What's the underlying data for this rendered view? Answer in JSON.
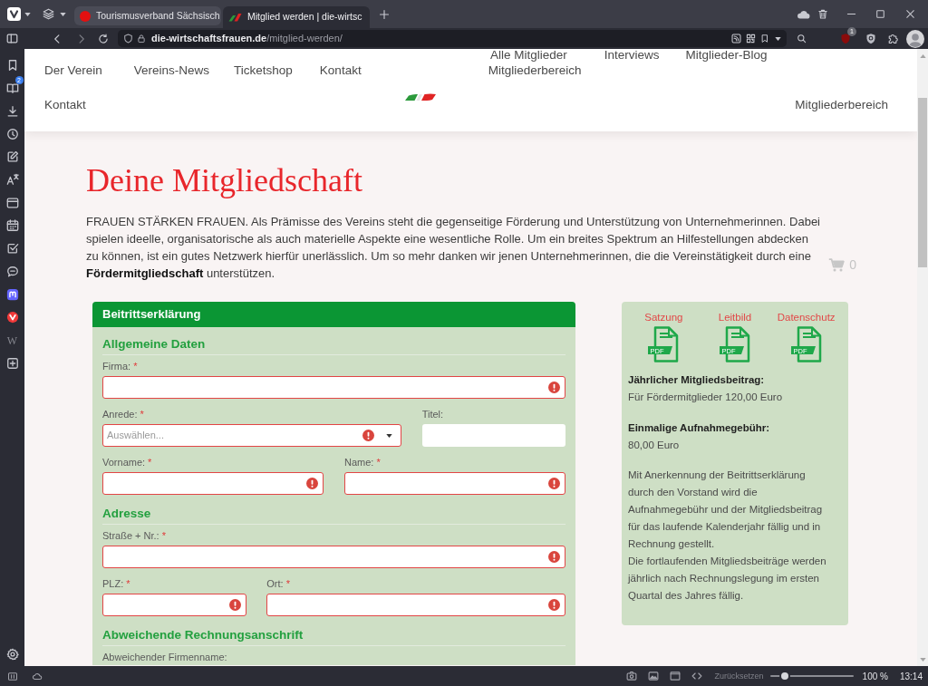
{
  "browser": {
    "tabs": [
      {
        "title": "Tourismusverband Sächsisch",
        "selected": false
      },
      {
        "title": "Mitglied werden | die-wirtsc",
        "selected": true
      }
    ],
    "address": "**die-wirtschaftsfrauen.de**/mitglied-werden/",
    "extension_badge": "1"
  },
  "side_panel": {
    "badge": "2",
    "web_panel_letter": "W"
  },
  "site": {
    "submenu": [
      "Alle Mitglieder",
      "Interviews",
      "Mitglieder-Blog"
    ],
    "nav": [
      "Der Verein",
      "Vereins-News",
      "Ticketshop",
      "Kontakt",
      "Mitgliederbereich"
    ],
    "nav_second_row": {
      "left": "Kontakt",
      "right": "Mitgliederbereich"
    }
  },
  "page": {
    "title": "Deine Mitgliedschaft",
    "intro": "FRAUEN STÄRKEN FRAUEN. Als Prämisse des Vereins steht die gegenseitige Förderung und Unterstützung von Unternehmerinnen. Dabei spielen ideelle, organisatorische als auch materielle Aspekte eine wesentliche Rolle. Um ein breites Spektrum an Hilfestellungen abdecken zu können, ist ein gutes Netzwerk hierfür unerlässlich. Um so mehr danken wir jenen Unternehmerinnen, die die Vereinstätigkeit durch eine **Fördermitgliedschaft** unterstützen.",
    "cart": {
      "count": "0"
    },
    "form": {
      "title": "Beitrittserklärung",
      "sections": [
        {
          "heading": "Allgemeine Daten",
          "rows": [
            [
              {
                "label": "Firma:",
                "required_mark": "*",
                "kind": "text",
                "invalid": true
              }
            ],
            [
              {
                "label": "Anrede:",
                "required_mark": "*",
                "kind": "select",
                "placeholder": "Auswählen...",
                "invalid": true
              },
              {
                "label": "Titel:",
                "kind": "text",
                "invalid": false
              }
            ],
            [
              {
                "label": "Vorname:",
                "required_mark": "*",
                "kind": "text",
                "invalid": true
              },
              {
                "label": "Name:",
                "required_mark": "*",
                "kind": "text",
                "invalid": true
              }
            ]
          ]
        },
        {
          "heading": "Adresse",
          "rows": [
            [
              {
                "label": "Straße + Nr.:",
                "required_mark": "*",
                "kind": "text",
                "invalid": true
              }
            ],
            [
              {
                "label": "PLZ:",
                "required_mark": "*",
                "kind": "text",
                "invalid": true
              },
              {
                "label": "Ort:",
                "required_mark": "*",
                "kind": "text",
                "invalid": true
              }
            ]
          ]
        },
        {
          "heading": "Abweichende Rechnungsanschrift",
          "rows": [
            [
              {
                "label": "Abweichender Firmenname:",
                "kind": "cutoff"
              }
            ]
          ]
        }
      ]
    },
    "info": {
      "documents": [
        {
          "label": "Satzung",
          "badge": "PDF"
        },
        {
          "label": "Leitbild",
          "badge": "PDF"
        },
        {
          "label": "Datenschutz",
          "badge": "PDF"
        }
      ],
      "fees": [
        {
          "heading": "Jährlicher Mitgliedsbeitrag:",
          "text": "Für Fördermitglieder 120,00 Euro"
        },
        {
          "heading": "Einmalige Aufnahmegebühr:",
          "text": "80,00 Euro"
        }
      ],
      "notes": [
        "Mit Anerkennung der Beitrittserklärung durch den Vorstand wird die Aufnahmegebühr und der Mitgliedsbeitrag für das laufende Kalenderjahr fällig und in Rechnung gestellt.",
        "Die fortlaufenden Mitgliedsbeiträge werden jährlich nach Rechnungslegung im ersten Quartal des Jahres fällig."
      ]
    }
  },
  "status_bar": {
    "reset": "Zurücksetzen",
    "zoom": {
      "level": 0.18,
      "reading": "100 %"
    },
    "clock": "13:14"
  }
}
